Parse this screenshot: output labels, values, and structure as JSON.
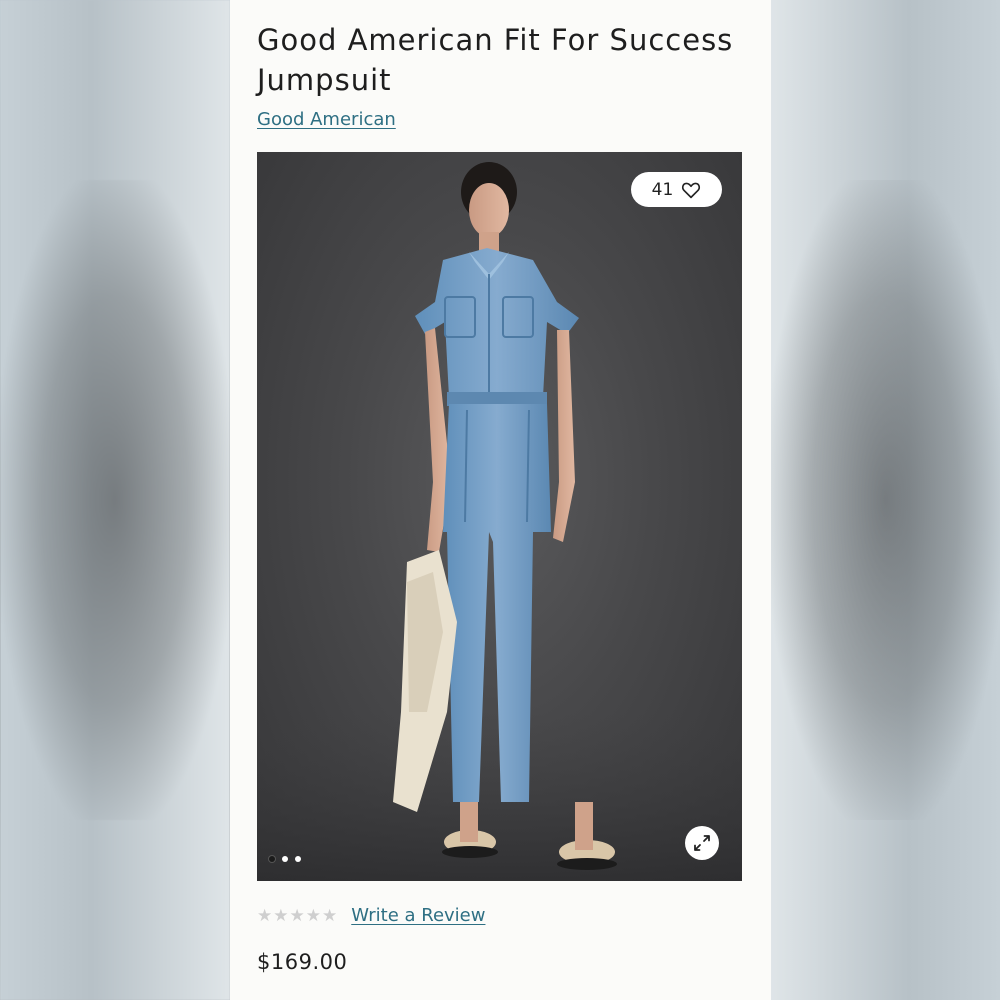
{
  "product": {
    "title": "Good American Fit For Success Jumpsuit",
    "brand": "Good American",
    "price": "$169.00"
  },
  "gallery": {
    "like_count": "41",
    "heart_icon": "heart-outline-icon",
    "expand_icon": "expand-arrows-icon",
    "slide_count": 3,
    "active_slide": 1
  },
  "reviews": {
    "rating": 0,
    "max_rating": 5,
    "write_review_label": "Write a Review",
    "star_glyph": "★"
  },
  "colors": {
    "link": "#2e6f83",
    "background_card": "#fbfbf9",
    "photo_backdrop": "#48484a",
    "star_empty": "#cfcfcf",
    "denim": "#6f9cc4"
  }
}
